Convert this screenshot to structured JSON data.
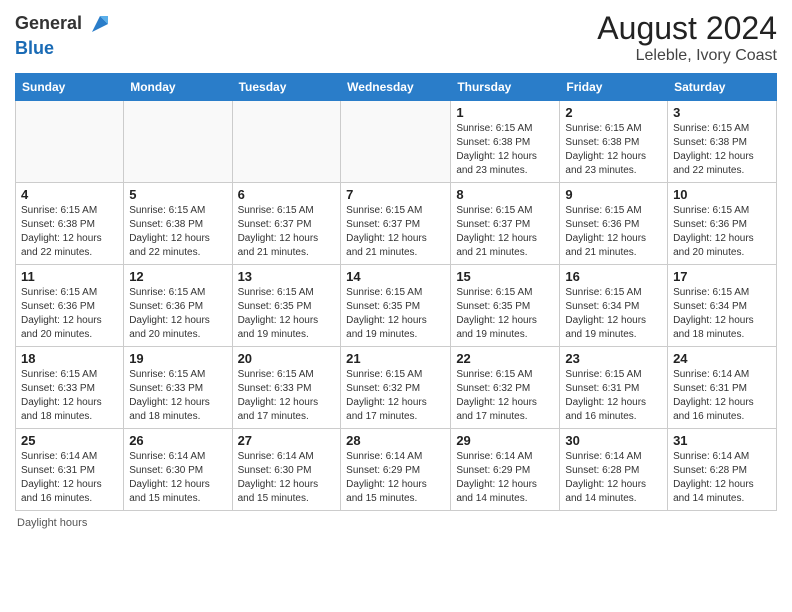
{
  "header": {
    "logo_general": "General",
    "logo_blue": "Blue",
    "month_year": "August 2024",
    "location": "Leleble, Ivory Coast"
  },
  "days_of_week": [
    "Sunday",
    "Monday",
    "Tuesday",
    "Wednesday",
    "Thursday",
    "Friday",
    "Saturday"
  ],
  "weeks": [
    [
      {
        "day": "",
        "info": ""
      },
      {
        "day": "",
        "info": ""
      },
      {
        "day": "",
        "info": ""
      },
      {
        "day": "",
        "info": ""
      },
      {
        "day": "1",
        "info": "Sunrise: 6:15 AM\nSunset: 6:38 PM\nDaylight: 12 hours\nand 23 minutes."
      },
      {
        "day": "2",
        "info": "Sunrise: 6:15 AM\nSunset: 6:38 PM\nDaylight: 12 hours\nand 23 minutes."
      },
      {
        "day": "3",
        "info": "Sunrise: 6:15 AM\nSunset: 6:38 PM\nDaylight: 12 hours\nand 22 minutes."
      }
    ],
    [
      {
        "day": "4",
        "info": "Sunrise: 6:15 AM\nSunset: 6:38 PM\nDaylight: 12 hours\nand 22 minutes."
      },
      {
        "day": "5",
        "info": "Sunrise: 6:15 AM\nSunset: 6:38 PM\nDaylight: 12 hours\nand 22 minutes."
      },
      {
        "day": "6",
        "info": "Sunrise: 6:15 AM\nSunset: 6:37 PM\nDaylight: 12 hours\nand 21 minutes."
      },
      {
        "day": "7",
        "info": "Sunrise: 6:15 AM\nSunset: 6:37 PM\nDaylight: 12 hours\nand 21 minutes."
      },
      {
        "day": "8",
        "info": "Sunrise: 6:15 AM\nSunset: 6:37 PM\nDaylight: 12 hours\nand 21 minutes."
      },
      {
        "day": "9",
        "info": "Sunrise: 6:15 AM\nSunset: 6:36 PM\nDaylight: 12 hours\nand 21 minutes."
      },
      {
        "day": "10",
        "info": "Sunrise: 6:15 AM\nSunset: 6:36 PM\nDaylight: 12 hours\nand 20 minutes."
      }
    ],
    [
      {
        "day": "11",
        "info": "Sunrise: 6:15 AM\nSunset: 6:36 PM\nDaylight: 12 hours\nand 20 minutes."
      },
      {
        "day": "12",
        "info": "Sunrise: 6:15 AM\nSunset: 6:36 PM\nDaylight: 12 hours\nand 20 minutes."
      },
      {
        "day": "13",
        "info": "Sunrise: 6:15 AM\nSunset: 6:35 PM\nDaylight: 12 hours\nand 19 minutes."
      },
      {
        "day": "14",
        "info": "Sunrise: 6:15 AM\nSunset: 6:35 PM\nDaylight: 12 hours\nand 19 minutes."
      },
      {
        "day": "15",
        "info": "Sunrise: 6:15 AM\nSunset: 6:35 PM\nDaylight: 12 hours\nand 19 minutes."
      },
      {
        "day": "16",
        "info": "Sunrise: 6:15 AM\nSunset: 6:34 PM\nDaylight: 12 hours\nand 19 minutes."
      },
      {
        "day": "17",
        "info": "Sunrise: 6:15 AM\nSunset: 6:34 PM\nDaylight: 12 hours\nand 18 minutes."
      }
    ],
    [
      {
        "day": "18",
        "info": "Sunrise: 6:15 AM\nSunset: 6:33 PM\nDaylight: 12 hours\nand 18 minutes."
      },
      {
        "day": "19",
        "info": "Sunrise: 6:15 AM\nSunset: 6:33 PM\nDaylight: 12 hours\nand 18 minutes."
      },
      {
        "day": "20",
        "info": "Sunrise: 6:15 AM\nSunset: 6:33 PM\nDaylight: 12 hours\nand 17 minutes."
      },
      {
        "day": "21",
        "info": "Sunrise: 6:15 AM\nSunset: 6:32 PM\nDaylight: 12 hours\nand 17 minutes."
      },
      {
        "day": "22",
        "info": "Sunrise: 6:15 AM\nSunset: 6:32 PM\nDaylight: 12 hours\nand 17 minutes."
      },
      {
        "day": "23",
        "info": "Sunrise: 6:15 AM\nSunset: 6:31 PM\nDaylight: 12 hours\nand 16 minutes."
      },
      {
        "day": "24",
        "info": "Sunrise: 6:14 AM\nSunset: 6:31 PM\nDaylight: 12 hours\nand 16 minutes."
      }
    ],
    [
      {
        "day": "25",
        "info": "Sunrise: 6:14 AM\nSunset: 6:31 PM\nDaylight: 12 hours\nand 16 minutes."
      },
      {
        "day": "26",
        "info": "Sunrise: 6:14 AM\nSunset: 6:30 PM\nDaylight: 12 hours\nand 15 minutes."
      },
      {
        "day": "27",
        "info": "Sunrise: 6:14 AM\nSunset: 6:30 PM\nDaylight: 12 hours\nand 15 minutes."
      },
      {
        "day": "28",
        "info": "Sunrise: 6:14 AM\nSunset: 6:29 PM\nDaylight: 12 hours\nand 15 minutes."
      },
      {
        "day": "29",
        "info": "Sunrise: 6:14 AM\nSunset: 6:29 PM\nDaylight: 12 hours\nand 14 minutes."
      },
      {
        "day": "30",
        "info": "Sunrise: 6:14 AM\nSunset: 6:28 PM\nDaylight: 12 hours\nand 14 minutes."
      },
      {
        "day": "31",
        "info": "Sunrise: 6:14 AM\nSunset: 6:28 PM\nDaylight: 12 hours\nand 14 minutes."
      }
    ]
  ],
  "footer": {
    "daylight_label": "Daylight hours"
  }
}
